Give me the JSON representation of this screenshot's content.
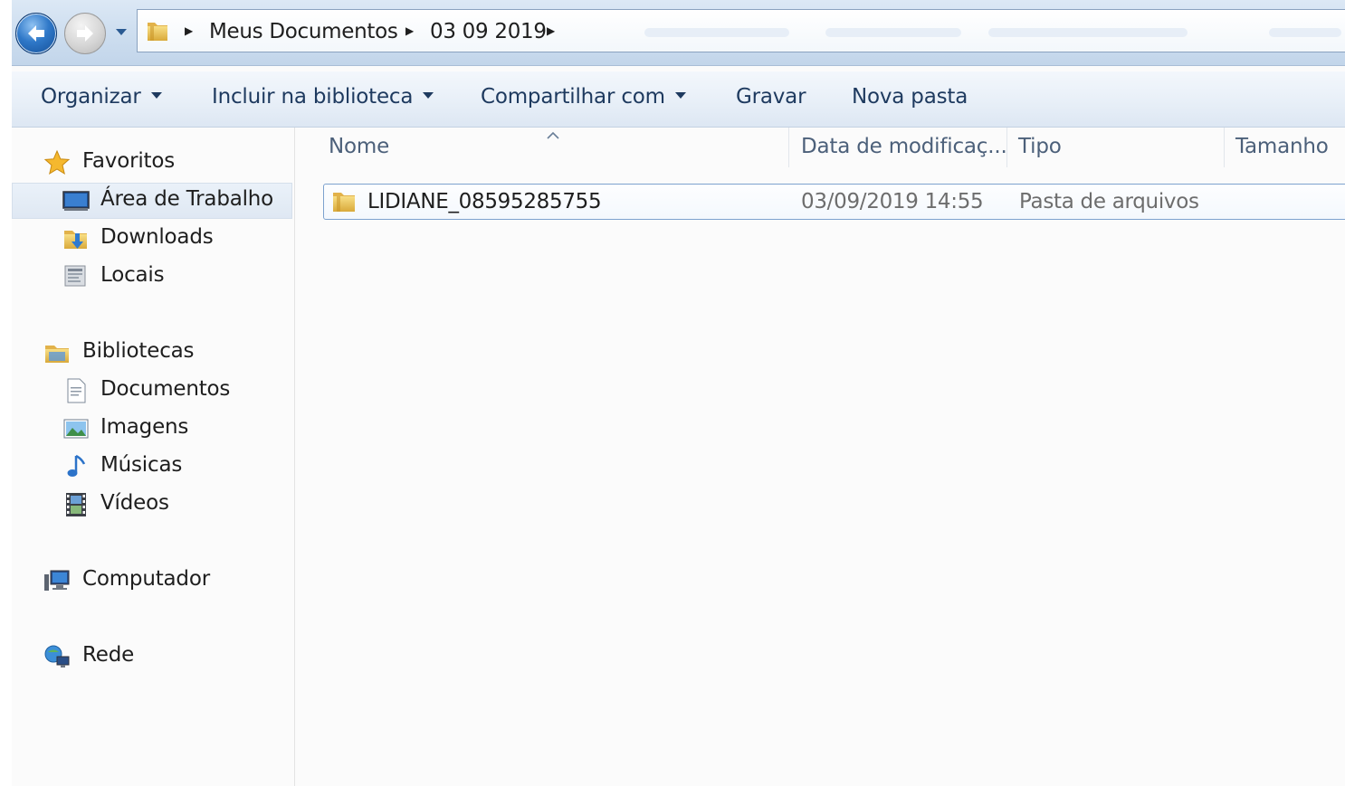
{
  "address": {
    "crumbs": [
      "Meus Documentos",
      "03 09 2019"
    ]
  },
  "toolbar": {
    "organize": "Organizar",
    "include_library": "Incluir na biblioteca",
    "share_with": "Compartilhar com",
    "burn": "Gravar",
    "new_folder": "Nova pasta"
  },
  "sidebar": {
    "favorites": "Favoritos",
    "desktop": "Área de Trabalho",
    "downloads": "Downloads",
    "recent_places": "Locais",
    "libraries": "Bibliotecas",
    "documents": "Documentos",
    "pictures": "Imagens",
    "music": "Músicas",
    "videos": "Vídeos",
    "computer": "Computador",
    "network": "Rede"
  },
  "columns": {
    "name": "Nome",
    "date_modified": "Data de modificaç...",
    "type": "Tipo",
    "size": "Tamanho"
  },
  "files": [
    {
      "name": "LIDIANE_08595285755",
      "date": "03/09/2019 14:55",
      "type": "Pasta de arquivos",
      "size": "",
      "icon": "folder-icon"
    }
  ],
  "colors": {
    "accent": "#2f78c8",
    "selection_border": "#7da2ce",
    "command_text": "#1e3a5f",
    "header_text": "#4c607a",
    "folder_yellow": "#e8c257"
  }
}
